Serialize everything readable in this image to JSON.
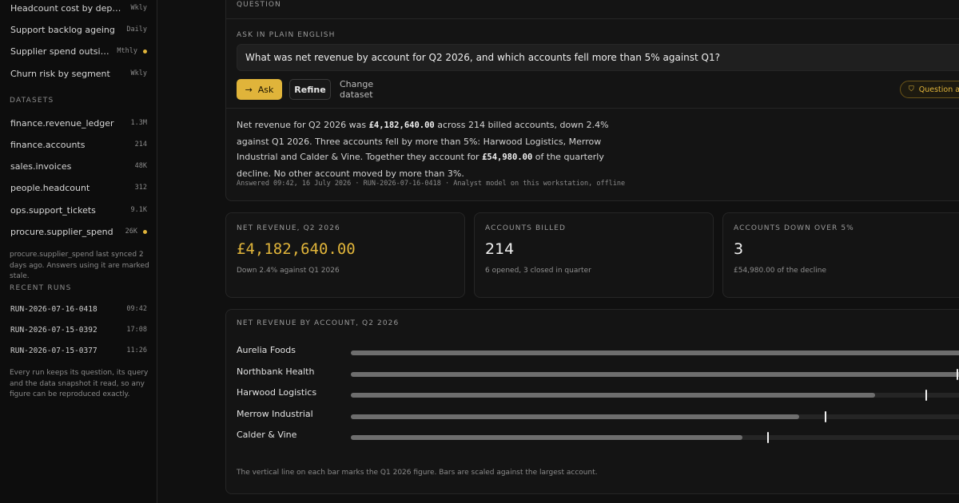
{
  "sidebar": {
    "saved_questions": [
      {
        "label": "Headcount cost by department",
        "freq": "Wkly",
        "stale": false
      },
      {
        "label": "Support backlog ageing",
        "freq": "Daily",
        "stale": false
      },
      {
        "label": "Supplier spend outside c...",
        "freq": "Mthly",
        "stale": true
      },
      {
        "label": "Churn risk by segment",
        "freq": "Wkly",
        "stale": false
      }
    ],
    "datasets_heading": "DATASETS",
    "datasets": [
      {
        "label": "finance.revenue_ledger",
        "size": "1.3M",
        "stale": false
      },
      {
        "label": "finance.accounts",
        "size": "214",
        "stale": false
      },
      {
        "label": "sales.invoices",
        "size": "48K",
        "stale": false
      },
      {
        "label": "people.headcount",
        "size": "312",
        "stale": false
      },
      {
        "label": "ops.support_tickets",
        "size": "9.1K",
        "stale": false
      },
      {
        "label": "procure.supplier_spend",
        "size": "26K",
        "stale": true
      }
    ],
    "stale_note": "procure.supplier_spend last synced 2 days ago. Answers using it are marked stale.",
    "runs_heading": "RECENT RUNS",
    "runs": [
      {
        "id": "RUN-2026-07-16-0418",
        "time": "09:42"
      },
      {
        "id": "RUN-2026-07-15-0392",
        "time": "17:08"
      },
      {
        "id": "RUN-2026-07-15-0377",
        "time": "11:26"
      }
    ],
    "runs_note": "Every run keeps its question, its query and the data snapshot it read, so any figure can be reproduced exactly."
  },
  "question": {
    "section_label": "QUESTION",
    "ask_label": "ASK IN PLAIN ENGLISH",
    "input_value": "What was net revenue by account for Q2 2026, and which accounts fell more than 5% against Q1?",
    "ask_button": "Ask",
    "refine_button": "Refine",
    "change_button": "Change dataset",
    "badge": "Question answered"
  },
  "answer": {
    "p1": "Net revenue for Q2 2026 was ",
    "amount": "£4,182,640.00",
    "p2": " across 214 billed accounts, down 2.4% against Q1 2026. Three accounts fell by more than 5%: Harwood Logistics, Merrow Industrial and Calder & Vine. Together they account for ",
    "decline": "£54,980.00",
    "p3": " of the quarterly decline. No other account moved by more than 3%.",
    "meta": "Answered 09:42, 16 July 2026 · RUN-2026-07-16-0418 · Analyst model on this workstation, offline"
  },
  "stats": [
    {
      "label": "NET REVENUE, Q2 2026",
      "value": "£4,182,640.00",
      "sub": "Down 2.4% against Q1 2026"
    },
    {
      "label": "ACCOUNTS BILLED",
      "value": "214",
      "sub": "6 opened, 3 closed in quarter"
    },
    {
      "label": "ACCOUNTS DOWN OVER 5%",
      "value": "3",
      "sub": "£54,980.00 of the decline"
    }
  ],
  "chart": {
    "title": "NET REVENUE BY ACCOUNT, Q2 2026",
    "note": "The vertical line on each bar marks the Q1 2026 figure. Bars are scaled against the largest account."
  },
  "chart_data": {
    "type": "bar",
    "orientation": "horizontal",
    "categories": [
      "Aurelia Foods",
      "Northbank Health",
      "Harwood Logistics",
      "Merrow Industrial",
      "Calder & Vine"
    ],
    "series": [
      {
        "values": [
          1.0,
          0.99,
          0.83,
          0.71,
          0.62
        ]
      },
      {
        "values": [
          null,
          0.96,
          0.91,
          0.75,
          0.66
        ]
      }
    ]
  },
  "colors": {
    "accent": "#e0b43a",
    "bar": "#6e6e6e",
    "track": "#252525"
  }
}
